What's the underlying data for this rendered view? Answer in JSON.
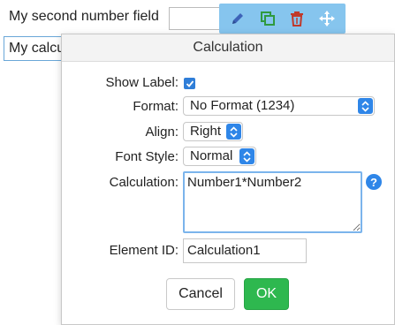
{
  "background_form": {
    "second_field_label": "My second number field",
    "calc_field_text": "My calculation"
  },
  "toolbar": {
    "icons": [
      "pencil-icon",
      "copy-icon",
      "trash-icon",
      "move-icon"
    ],
    "colors": {
      "background": "#86c5ee",
      "pencil": "#3d63b8",
      "copy": "#2f9a3f",
      "trash": "#c0392b",
      "move": "#ffffff"
    }
  },
  "dialog": {
    "title": "Calculation",
    "show_label": {
      "label": "Show Label:",
      "checked": true
    },
    "format": {
      "label": "Format:",
      "value": "No Format (1234)"
    },
    "align": {
      "label": "Align:",
      "value": "Right"
    },
    "font_style": {
      "label": "Font Style:",
      "value": "Normal"
    },
    "calculation": {
      "label": "Calculation:",
      "value": "Number1*Number2"
    },
    "element_id": {
      "label": "Element ID:",
      "value": "Calculation1"
    },
    "cancel_label": "Cancel",
    "ok_label": "OK",
    "help_symbol": "?"
  },
  "colors": {
    "accent": "#2f86e8",
    "ok": "#2eb84f"
  }
}
